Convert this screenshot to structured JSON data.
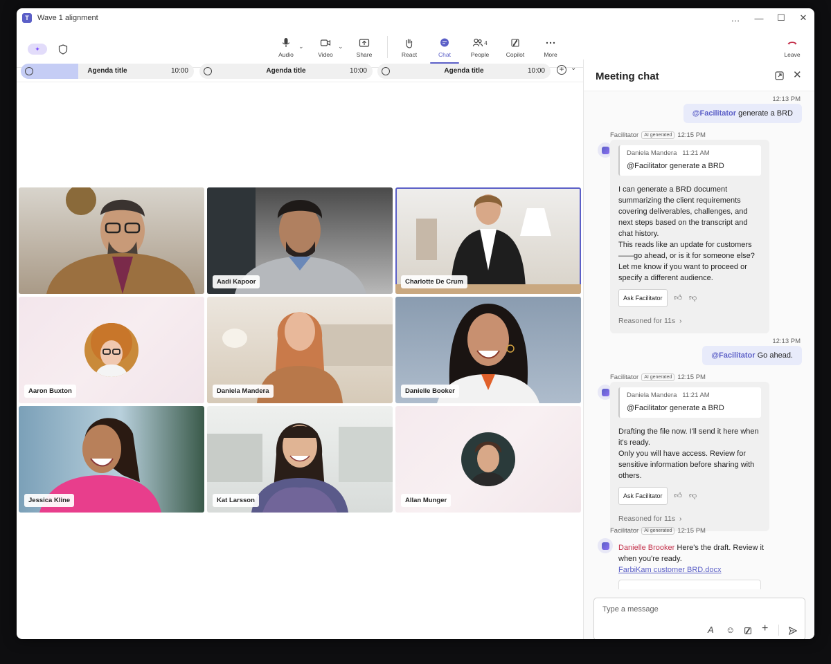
{
  "window": {
    "title": "Wave 1 alignment",
    "controls": [
      "…",
      "—",
      "☐",
      "✕"
    ]
  },
  "toolbar": {
    "audio": "Audio",
    "video": "Video",
    "share": "Share",
    "react": "React",
    "chat": "Chat",
    "people": "People",
    "people_count": "4",
    "copilot": "Copilot",
    "more": "More",
    "leave": "Leave"
  },
  "agenda": [
    {
      "title": "Agenda title",
      "time": "10:00",
      "progress": 0.33
    },
    {
      "title": "Agenda title",
      "time": "10:00",
      "progress": 0
    },
    {
      "title": "Agenda title",
      "time": "10:00",
      "progress": 0
    }
  ],
  "participants": [
    {
      "name": ""
    },
    {
      "name": "Aadi Kapoor"
    },
    {
      "name": "Charlotte De Crum"
    },
    {
      "name": "Aaron Buxton"
    },
    {
      "name": "Daniela Mandera"
    },
    {
      "name": "Danielle Booker"
    },
    {
      "name": "Jessica Kline"
    },
    {
      "name": "Kat Larsson"
    },
    {
      "name": "Allan Munger"
    }
  ],
  "chat": {
    "title": "Meeting chat",
    "msg1": {
      "time": "12:13 PM",
      "mention": "@Facilitator",
      "text": " generate a BRD"
    },
    "reply1": {
      "sender": "Facilitator",
      "badge": "AI generated",
      "time": "12:15 PM",
      "quote_author": "Daniela Mandera",
      "quote_time": "11:21 AM",
      "quote_text": "@Facilitator generate a BRD",
      "body": "I can generate a BRD document summarizing the client requirements covering deliverables, challenges, and next steps based on the transcript and chat history.\nThis reads like an update for customers ——go ahead, or is it for someone else? Let me know if you want to proceed or specify a different audience.",
      "ask": "Ask Facilitator",
      "reasoned": "Reasoned for 11s"
    },
    "msg2": {
      "time": "12:13 PM",
      "mention": "@Facilitator",
      "text": " Go ahead."
    },
    "reply2": {
      "sender": "Facilitator",
      "badge": "AI generated",
      "time": "12:15 PM",
      "quote_author": "Daniela Mandera",
      "quote_time": "11:21 AM",
      "quote_text": "@Facilitator generate a BRD",
      "body": "Drafting the file now. I'll send it here when it's ready.\nOnly you will have access. Review for sensitive information before sharing with others.",
      "ask": "Ask Facilitator",
      "reasoned": "Reasoned for 11s"
    },
    "reply3": {
      "sender": "Facilitator",
      "badge": "AI generated",
      "time": "12:15 PM",
      "mention": "Danielle Brooker",
      "text": " Here's the draft. Review it when you're ready.",
      "link": "FarbiKam customer BRD.docx"
    },
    "compose_placeholder": "Type a message"
  }
}
